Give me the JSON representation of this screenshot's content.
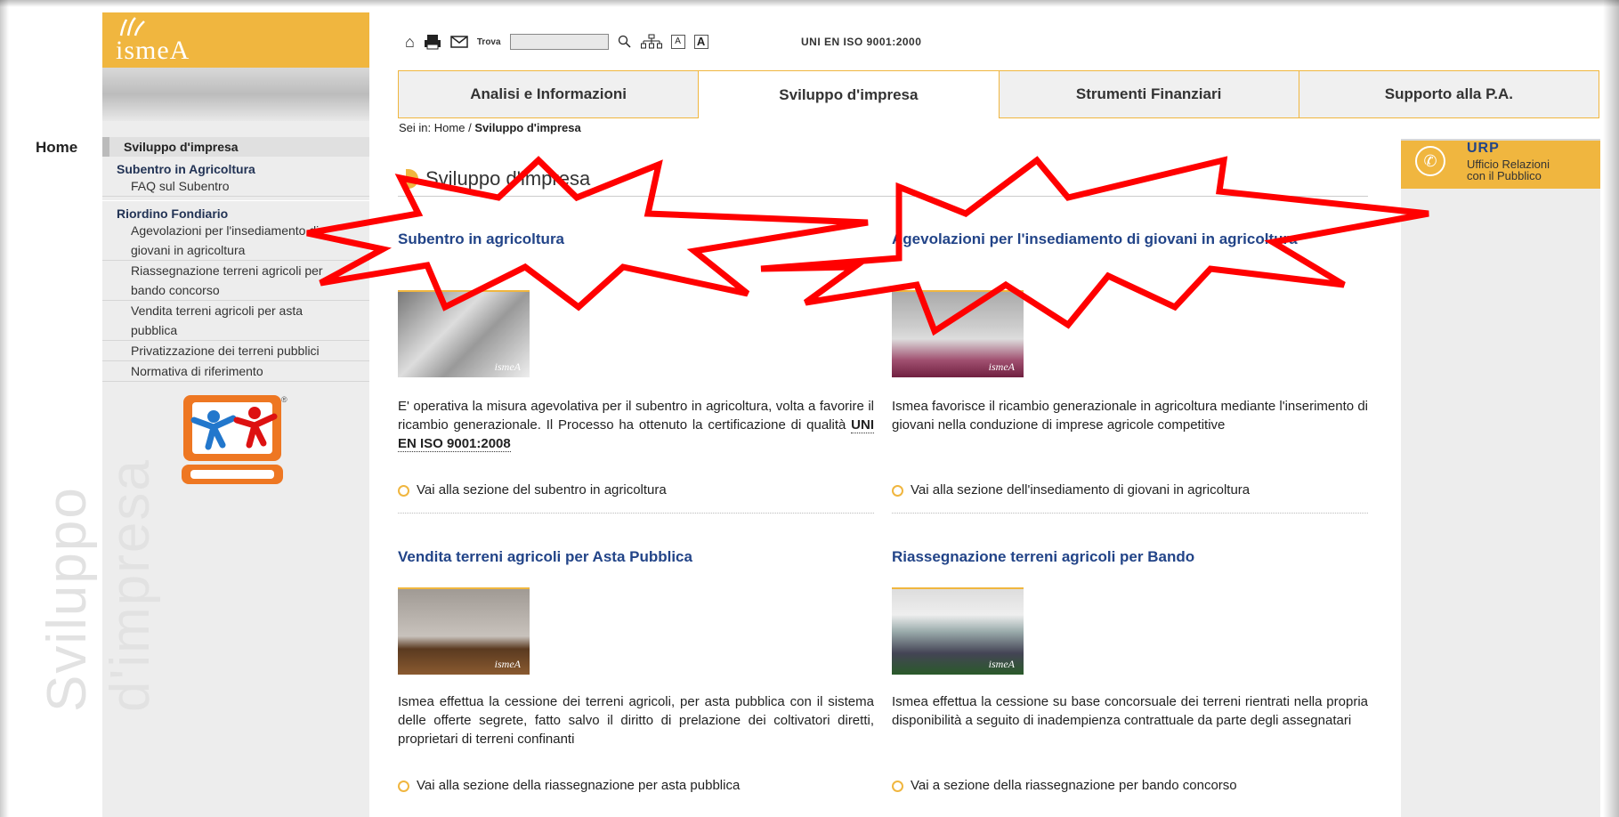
{
  "logo": {
    "text": "ismeA"
  },
  "sidebar": {
    "home": "Home",
    "vertical_text": "Sviluppo d'impresa",
    "current": "Sviluppo d'impresa",
    "sections": [
      {
        "title": "Subentro in Agricoltura",
        "items": [
          "FAQ sul Subentro"
        ]
      },
      {
        "title": "Riordino Fondiario",
        "items": [
          "Agevolazioni per l'insediamento di",
          "giovani in agricoltura",
          "Riassegnazione terreni agricoli per",
          "bando concorso",
          "Vendita terreni agricoli per asta",
          "pubblica",
          "Privatizzazione dei terreni pubblici",
          "Normativa di riferimento"
        ]
      }
    ]
  },
  "toolbar": {
    "find_label": "Trova",
    "find_placeholder": "",
    "iso": "UNI EN ISO 9001:2000",
    "home_icon": "home-icon",
    "print_icon": "print-icon",
    "mail_icon": "mail-icon",
    "search_icon": "search-icon",
    "sitemap_icon": "sitemap-icon",
    "font_small": "A",
    "font_large": "A"
  },
  "tabs": [
    {
      "label": "Analisi e Informazioni",
      "active": false
    },
    {
      "label": "Sviluppo d'impresa",
      "active": true
    },
    {
      "label": "Strumenti Finanziari",
      "active": false
    },
    {
      "label": "Supporto alla P.A.",
      "active": false
    }
  ],
  "breadcrumb": {
    "prefix": "Sei in:",
    "home": "Home",
    "sep": "/",
    "current": "Sviluppo d'impresa"
  },
  "main": {
    "title": "Sviluppo d'impresa",
    "articles": [
      {
        "title": "Subentro in agricoltura",
        "text_a": "E' operativa la misura agevolativa per il subentro in agricoltura, volta a favorire il ricambio generazionale. Il Processo ha ottenuto la certificazione di qualità ",
        "text_b": "UNI EN ISO 9001:2008",
        "link": "Vai alla sezione del subentro in agricoltura"
      },
      {
        "title": "Agevolazioni per l'insediamento di giovani in agricoltura",
        "text_a": "Ismea favorisce il ricambio generazionale in agricoltura mediante l'inserimento di giovani nella conduzione di imprese agricole competitive",
        "link": "Vai alla sezione dell'insediamento di giovani in agricoltura"
      },
      {
        "title": "Vendita terreni agricoli per Asta Pubblica",
        "text_a": "Ismea effettua la cessione dei terreni agricoli, per asta pubblica con il sistema delle offerte segrete, fatto salvo il diritto di prelazione dei coltivatori diretti, proprietari di terreni confinanti",
        "link": "Vai alla sezione della riassegnazione per asta pubblica"
      },
      {
        "title": "Riassegnazione terreni agricoli per Bando",
        "text_a": "Ismea effettua la cessione su base concorsuale dei terreni rientrati nella propria disponibilità a seguito di inadempienza contrattuale da parte degli assegnatari",
        "link": "Vai a sezione della riassegnazione per bando concorso"
      }
    ],
    "thumb_label": "ismeA"
  },
  "urp": {
    "title": "URP",
    "subtitle_1": "Ufficio Relazioni",
    "subtitle_2": "con il Pubblico",
    "icon": "phone-icon"
  },
  "colors": {
    "accent": "#f0b63f",
    "title_blue": "#224488",
    "annotation_red": "#ff0000"
  }
}
